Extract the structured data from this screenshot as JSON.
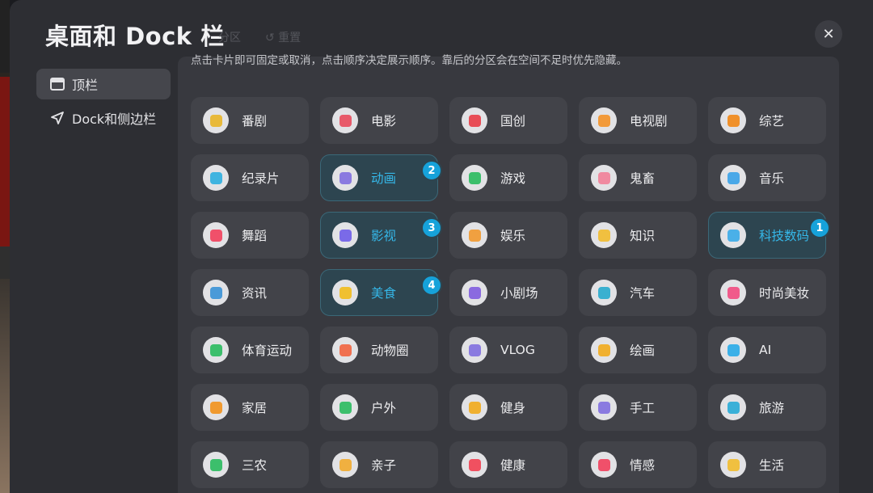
{
  "title": "桌面和 Dock 栏",
  "ghost": {
    "partition_tail": "分区",
    "reset": "↺ 重置"
  },
  "close_label": "✕",
  "hint": "点击卡片即可固定或取消，点击顺序决定展示顺序。靠后的分区会在空间不足时优先隐藏。",
  "nav": [
    {
      "label": "顶栏",
      "active": true
    },
    {
      "label": "Dock和侧边栏",
      "active": false
    }
  ],
  "cards": [
    {
      "label": "番剧",
      "icon": "bangumi-tv-icon",
      "color": "#e8b93a"
    },
    {
      "label": "电影",
      "icon": "3d-glasses-icon",
      "color": "#e85a6a"
    },
    {
      "label": "国创",
      "icon": "gourd-icon",
      "color": "#e84d56"
    },
    {
      "label": "电视剧",
      "icon": "sofa-icon",
      "color": "#f29a3a"
    },
    {
      "label": "综艺",
      "icon": "microphone-icon",
      "color": "#f0902a"
    },
    {
      "label": "纪录片",
      "icon": "dolphin-icon",
      "color": "#3fb4e0"
    },
    {
      "label": "动画",
      "icon": "play-icon",
      "color": "#8a7ae0",
      "badge": "2"
    },
    {
      "label": "游戏",
      "icon": "creeper-icon",
      "color": "#3cbf6c"
    },
    {
      "label": "鬼畜",
      "icon": "pig-face-icon",
      "color": "#f08aa0"
    },
    {
      "label": "音乐",
      "icon": "headphones-icon",
      "color": "#4aa8e8"
    },
    {
      "label": "舞蹈",
      "icon": "fan-icon",
      "color": "#f0506a"
    },
    {
      "label": "影视",
      "icon": "clapper-icon",
      "color": "#7a6ae8",
      "badge": "3"
    },
    {
      "label": "娱乐",
      "icon": "magic-wand-icon",
      "color": "#f0a040"
    },
    {
      "label": "知识",
      "icon": "lightbulb-icon",
      "color": "#f0c040"
    },
    {
      "label": "科技数码",
      "icon": "ufo-icon",
      "color": "#4ab0e8",
      "badge": "1"
    },
    {
      "label": "资讯",
      "icon": "newspaper-icon",
      "color": "#4a9ad8"
    },
    {
      "label": "美食",
      "icon": "food-cover-icon",
      "color": "#f0c030",
      "badge": "4"
    },
    {
      "label": "小剧场",
      "icon": "stage-icon",
      "color": "#8a6ae0"
    },
    {
      "label": "汽车",
      "icon": "car-icon",
      "color": "#3ab0d0"
    },
    {
      "label": "时尚美妆",
      "icon": "dress-icon",
      "color": "#f05a8a"
    },
    {
      "label": "体育运动",
      "icon": "runner-icon",
      "color": "#3cbf6c"
    },
    {
      "label": "动物圈",
      "icon": "paw-icon",
      "color": "#f07050"
    },
    {
      "label": "VLOG",
      "icon": "vlog-icon",
      "color": "#8a7ae0"
    },
    {
      "label": "绘画",
      "icon": "palette-icon",
      "color": "#f0b030"
    },
    {
      "label": "AI",
      "icon": "ai-icon",
      "color": "#3ab0e8"
    },
    {
      "label": "家居",
      "icon": "cabinet-icon",
      "color": "#f09a30"
    },
    {
      "label": "户外",
      "icon": "mountain-icon",
      "color": "#3cbf6c"
    },
    {
      "label": "健身",
      "icon": "dumbbell-icon",
      "color": "#f0b030"
    },
    {
      "label": "手工",
      "icon": "scissors-icon",
      "color": "#8a7ae0"
    },
    {
      "label": "旅游",
      "icon": "suitcase-icon",
      "color": "#3ab0d8"
    },
    {
      "label": "三农",
      "icon": "sprout-icon",
      "color": "#3cbf6c"
    },
    {
      "label": "亲子",
      "icon": "rocking-horse-icon",
      "color": "#f0b040"
    },
    {
      "label": "健康",
      "icon": "first-aid-icon",
      "color": "#f05060"
    },
    {
      "label": "情感",
      "icon": "heart-icon",
      "color": "#f0506a"
    },
    {
      "label": "生活",
      "icon": "duck-icon",
      "color": "#f0c040"
    }
  ]
}
